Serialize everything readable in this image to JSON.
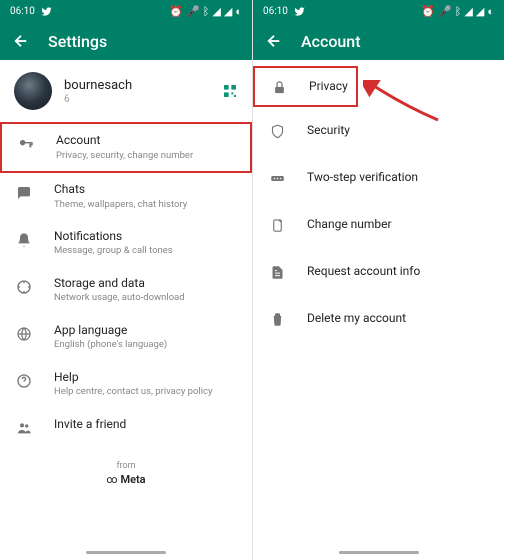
{
  "status": {
    "time": "06:10"
  },
  "left": {
    "title": "Settings",
    "profile": {
      "name": "bournesach",
      "status": "6"
    },
    "items": [
      {
        "title": "Account",
        "subtitle": "Privacy, security, change number"
      },
      {
        "title": "Chats",
        "subtitle": "Theme, wallpapers, chat history"
      },
      {
        "title": "Notifications",
        "subtitle": "Message, group & call tones"
      },
      {
        "title": "Storage and data",
        "subtitle": "Network usage, auto-download"
      },
      {
        "title": "App language",
        "subtitle": "English (phone's language)"
      },
      {
        "title": "Help",
        "subtitle": "Help centre, contact us, privacy policy"
      },
      {
        "title": "Invite a friend",
        "subtitle": ""
      }
    ],
    "footer": {
      "from": "from",
      "meta": "Meta"
    }
  },
  "right": {
    "title": "Account",
    "items": [
      {
        "title": "Privacy"
      },
      {
        "title": "Security"
      },
      {
        "title": "Two-step verification"
      },
      {
        "title": "Change number"
      },
      {
        "title": "Request account info"
      },
      {
        "title": "Delete my account"
      }
    ]
  }
}
